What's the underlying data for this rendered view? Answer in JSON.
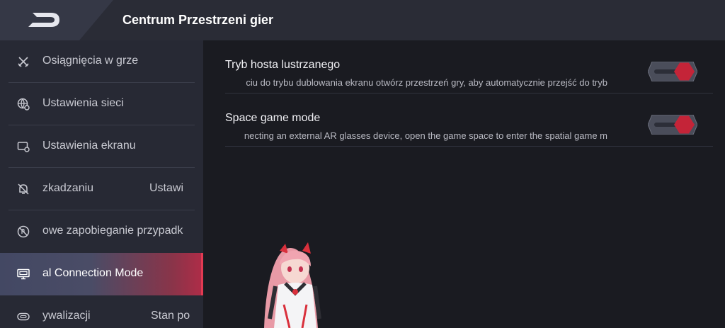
{
  "header": {
    "title": "Centrum Przestrzeni gier",
    "back_icon": "back-logo-icon"
  },
  "sidebar": {
    "items": [
      {
        "label": "Osiągnięcia w grze",
        "icon": "crossed-swords-icon"
      },
      {
        "label": "Ustawienia sieci",
        "icon": "globe-settings-icon"
      },
      {
        "label": "Ustawienia ekranu",
        "icon": "screen-settings-icon"
      },
      {
        "label": "zkadzaniu",
        "extra": "Ustawi",
        "icon": "bell-off-icon"
      },
      {
        "label": "owe zapobieganie przypadk",
        "icon": "no-touch-icon"
      },
      {
        "label": "al Connection Mode",
        "icon": "monitor-icon",
        "active": true
      },
      {
        "label": "ywalizacji",
        "extra": "Stan po",
        "icon": "gamepad-icon"
      }
    ]
  },
  "settings": [
    {
      "title": "Tryb hosta lustrzanego",
      "description": "ciu do trybu dublowania ekranu otwórz przestrzeń gry, aby automatycznie przejść do tryb",
      "toggle_on": true
    },
    {
      "title": "Space game mode",
      "description": "necting an external AR glasses device, open the game space to enter the spatial game m",
      "toggle_on": true
    }
  ],
  "colors": {
    "accent": "#c42438",
    "sidebar_bg": "#272934",
    "content_bg": "#1a1b21",
    "topbar_bg": "#2a2c36"
  }
}
